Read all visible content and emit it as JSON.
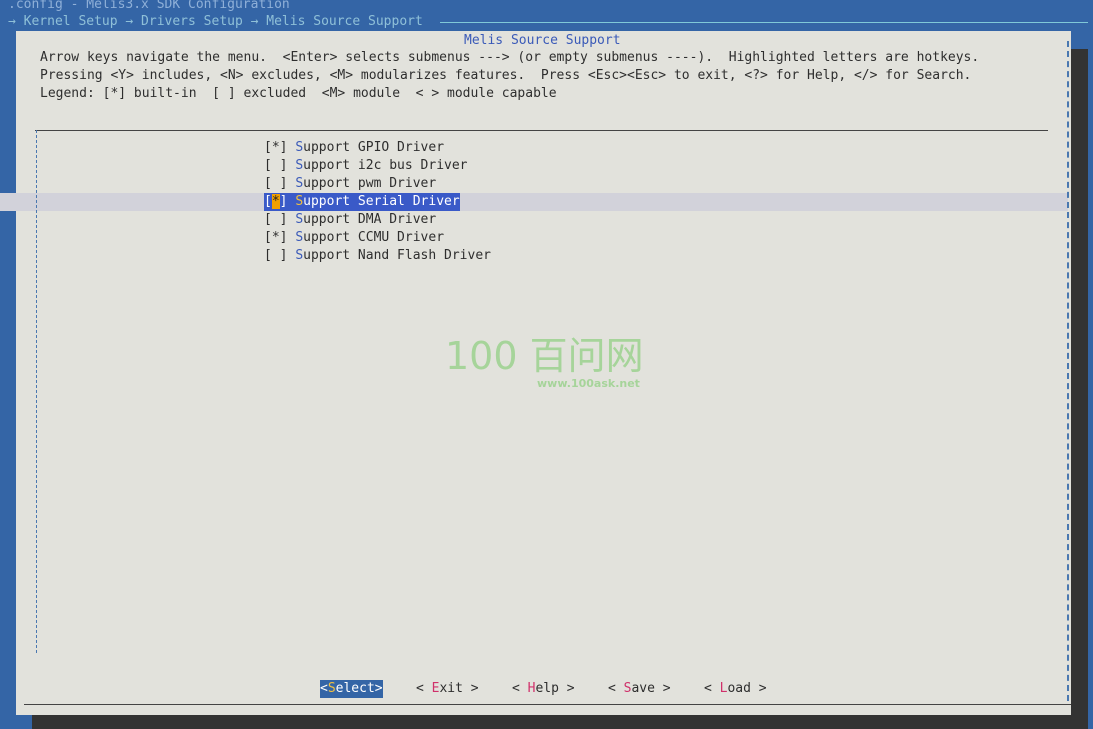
{
  "window": {
    "title": ".config - Melis3.x SDK Configuration",
    "breadcrumb": "→ Kernel Setup → Drivers Setup → Melis Source Support"
  },
  "dialog": {
    "title": "Melis Source Support",
    "help_lines": [
      "Arrow keys navigate the menu.  <Enter> selects submenus ---> (or empty submenus ----).  Highlighted letters are hotkeys.",
      "Pressing <Y> includes, <N> excludes, <M> modularizes features.  Press <Esc><Esc> to exit, <?> for Help, </> for Search.",
      "Legend: [*] built-in  [ ] excluded  <M> module  < > module capable"
    ],
    "items": [
      {
        "state": "*",
        "hotkey": "S",
        "rest": "upport GPIO Driver"
      },
      {
        "state": " ",
        "hotkey": "S",
        "rest": "upport i2c bus Driver"
      },
      {
        "state": " ",
        "hotkey": "S",
        "rest": "upport pwm Driver"
      },
      {
        "state": "*",
        "hotkey": "S",
        "rest": "upport Serial Driver",
        "selected": true
      },
      {
        "state": " ",
        "hotkey": "S",
        "rest": "upport DMA Driver"
      },
      {
        "state": "*",
        "hotkey": "S",
        "rest": "upport CCMU Driver"
      },
      {
        "state": " ",
        "hotkey": "S",
        "rest": "upport Nand Flash Driver"
      }
    ],
    "buttons": [
      {
        "pre": "<",
        "hotkey": "S",
        "rest": "elect>",
        "active": true
      },
      {
        "pre": "< ",
        "hotkey": "E",
        "rest": "xit >"
      },
      {
        "pre": "< ",
        "hotkey": "H",
        "rest": "elp >"
      },
      {
        "pre": "< ",
        "hotkey": "S",
        "rest": "ave >"
      },
      {
        "pre": "< ",
        "hotkey": "L",
        "rest": "oad >"
      }
    ]
  },
  "watermark": {
    "logo": "100 百问网",
    "url": "www.100ask.net"
  },
  "colors": {
    "background": "#3465a6",
    "dialog": "#e2e2dc",
    "selection": "#3a5ac8",
    "hotkey": "#d0306a"
  }
}
